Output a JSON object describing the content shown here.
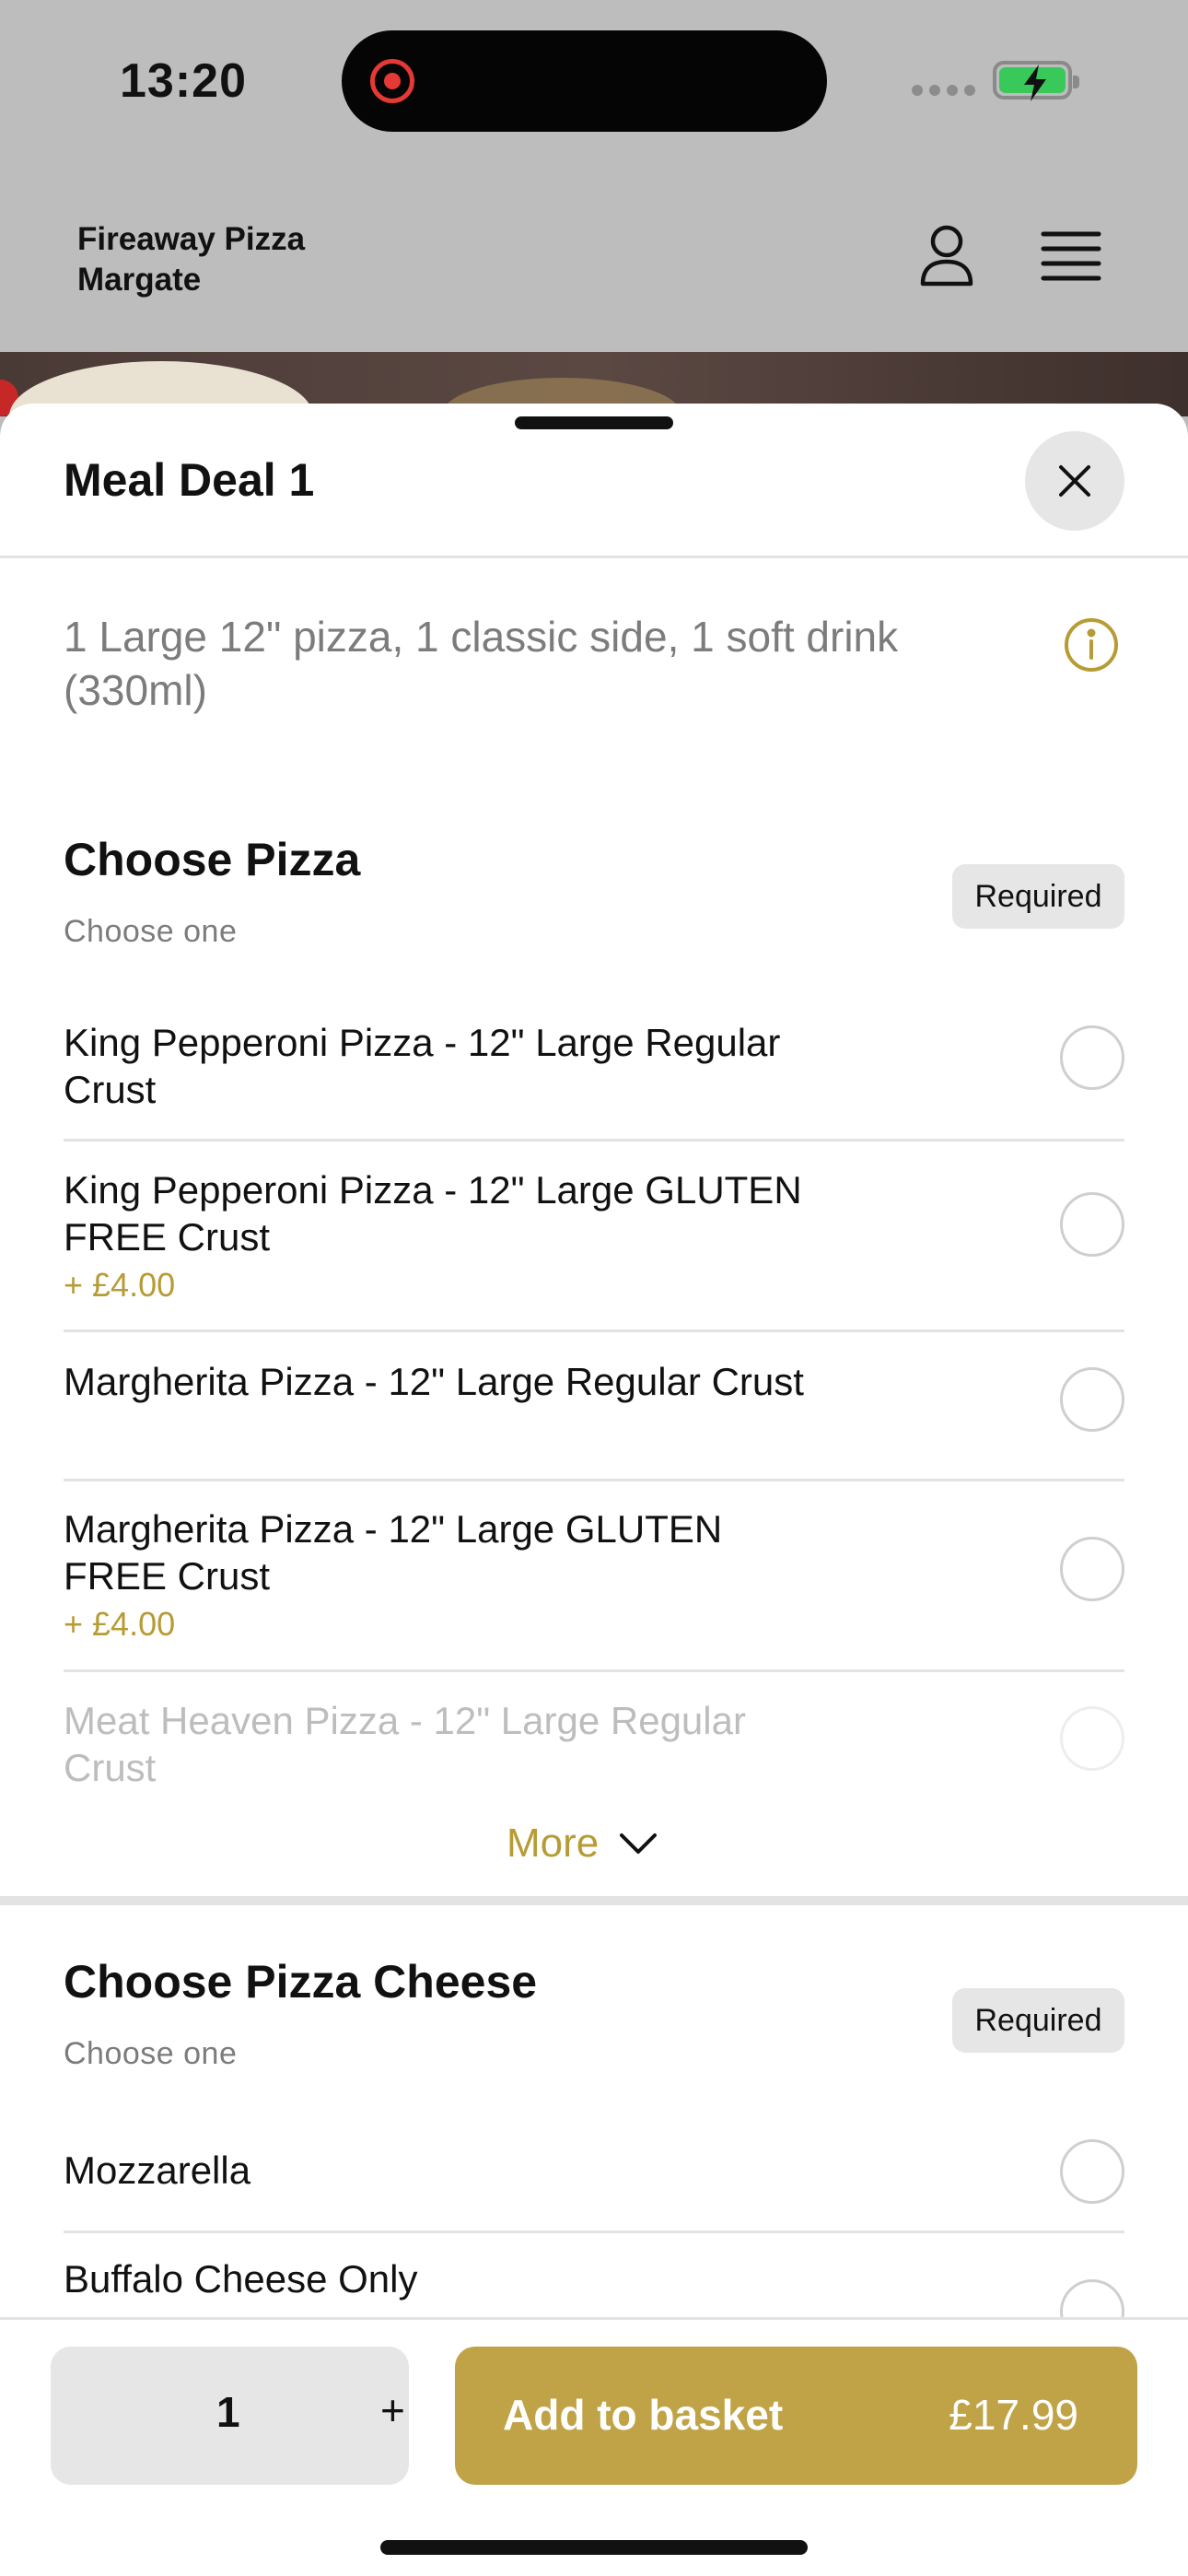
{
  "status_bar": {
    "time": "13:20"
  },
  "header": {
    "store_name_line1": "Fireaway Pizza",
    "store_name_line2": "Margate"
  },
  "sheet": {
    "title": "Meal Deal 1",
    "description": "1 Large 12\" pizza, 1 classic side, 1 soft drink (330ml)"
  },
  "sections": [
    {
      "title": "Choose Pizza",
      "subtitle": "Choose one",
      "badge": "Required",
      "options": [
        {
          "name": "King Pepperoni Pizza - 12\" Large Regular Crust",
          "price": ""
        },
        {
          "name": "King Pepperoni Pizza - 12\" Large GLUTEN FREE Crust",
          "price": "+ £4.00"
        },
        {
          "name": "Margherita Pizza - 12\" Large Regular Crust",
          "price": ""
        },
        {
          "name": "Margherita Pizza - 12\" Large GLUTEN FREE Crust",
          "price": "+ £4.00"
        },
        {
          "name": "Meat Heaven Pizza - 12\" Large Regular Crust",
          "price": ""
        }
      ],
      "more_label": "More"
    },
    {
      "title": "Choose Pizza Cheese",
      "subtitle": "Choose one",
      "badge": "Required",
      "options": [
        {
          "name": "Mozzarella",
          "price": ""
        },
        {
          "name": "Buffalo Cheese Only",
          "price": ""
        }
      ]
    }
  ],
  "footer": {
    "quantity": "1",
    "plus_label": "+",
    "add_label": "Add to basket",
    "total": "£17.99"
  },
  "colors": {
    "accent": "#c1a347",
    "accent_text": "#b79c35",
    "header_bg": "#bdbdbd"
  }
}
